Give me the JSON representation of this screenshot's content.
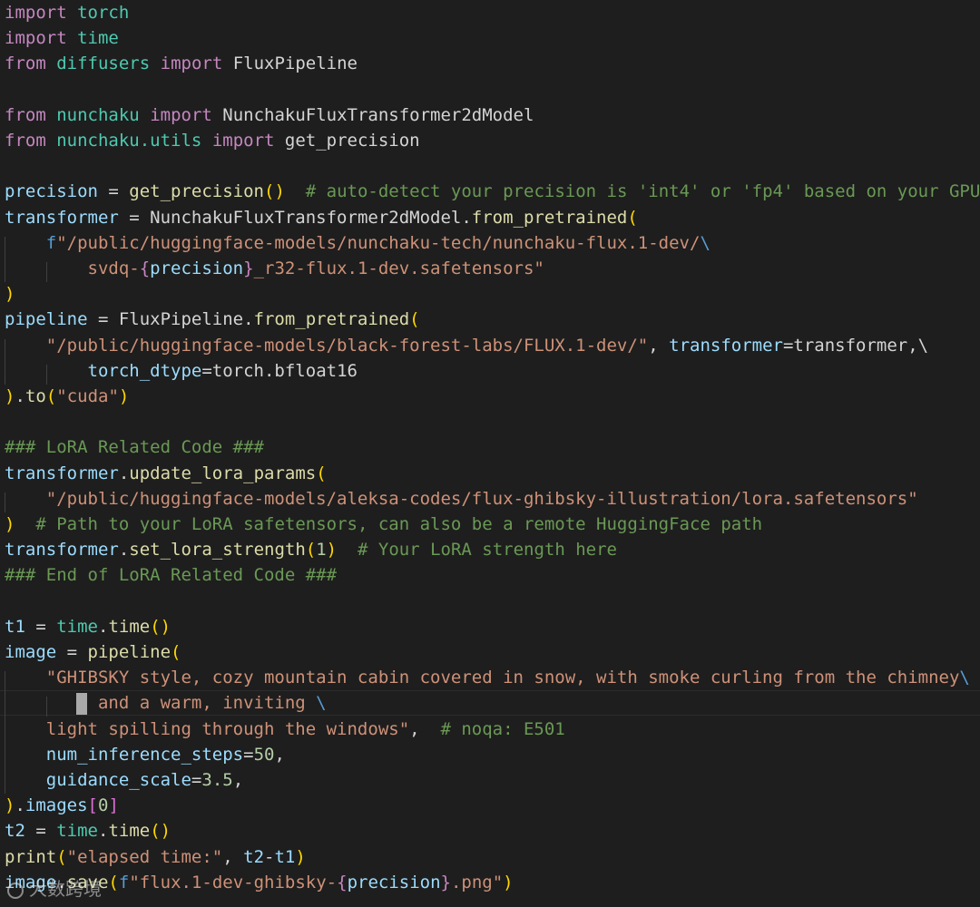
{
  "colors": {
    "background": "#1e1e1e",
    "keyword": "#c586c0",
    "function": "#dcdcaa",
    "variable": "#9cdcfe",
    "module": "#4ec9b0",
    "string": "#ce9178",
    "comment": "#6a9955",
    "number": "#b5cea8"
  },
  "editor": {
    "lines": [
      [
        {
          "t": "import",
          "c": "kw"
        },
        {
          "t": " "
        },
        {
          "t": "torch",
          "c": "mod"
        }
      ],
      [
        {
          "t": "import",
          "c": "kw"
        },
        {
          "t": " "
        },
        {
          "t": "time",
          "c": "mod"
        }
      ],
      [
        {
          "t": "from",
          "c": "kw"
        },
        {
          "t": " "
        },
        {
          "t": "diffusers",
          "c": "mod"
        },
        {
          "t": " "
        },
        {
          "t": "import",
          "c": "kw"
        },
        {
          "t": " FluxPipeline"
        }
      ],
      [],
      [
        {
          "t": "from",
          "c": "kw"
        },
        {
          "t": " "
        },
        {
          "t": "nunchaku",
          "c": "mod"
        },
        {
          "t": " "
        },
        {
          "t": "import",
          "c": "kw"
        },
        {
          "t": " NunchakuFluxTransformer2dModel"
        }
      ],
      [
        {
          "t": "from",
          "c": "kw"
        },
        {
          "t": " "
        },
        {
          "t": "nunchaku.utils",
          "c": "mod"
        },
        {
          "t": " "
        },
        {
          "t": "import",
          "c": "kw"
        },
        {
          "t": " get_precision"
        }
      ],
      [],
      [
        {
          "t": "precision",
          "c": "var"
        },
        {
          "t": " = "
        },
        {
          "t": "get_precision",
          "c": "fn"
        },
        {
          "t": "()",
          "c": "p1"
        },
        {
          "t": "  "
        },
        {
          "t": "# auto-detect your precision is 'int4' or 'fp4' based on your GPU",
          "c": "com"
        }
      ],
      [
        {
          "t": "transformer",
          "c": "var"
        },
        {
          "t": " = NunchakuFluxTransformer2dModel."
        },
        {
          "t": "from_pretrained",
          "c": "fn"
        },
        {
          "t": "(",
          "c": "p1"
        }
      ],
      [
        {
          "t": "    "
        },
        {
          "t": "f",
          "c": "fstr"
        },
        {
          "t": "\"/public/huggingface-models/nunchaku-tech/nunchaku-flux.1-dev/",
          "c": "str"
        },
        {
          "t": "\\",
          "c": "fstr"
        }
      ],
      [
        {
          "t": "        "
        },
        {
          "t": "svdq-",
          "c": "str"
        },
        {
          "t": "{",
          "c": "brace"
        },
        {
          "t": "precision",
          "c": "var"
        },
        {
          "t": "}",
          "c": "brace"
        },
        {
          "t": "_r32-flux.1-dev.safetensors\"",
          "c": "str"
        }
      ],
      [
        {
          "t": ")",
          "c": "p1"
        }
      ],
      [
        {
          "t": "pipeline",
          "c": "var"
        },
        {
          "t": " = FluxPipeline."
        },
        {
          "t": "from_pretrained",
          "c": "fn"
        },
        {
          "t": "(",
          "c": "p1"
        }
      ],
      [
        {
          "t": "    "
        },
        {
          "t": "\"/public/huggingface-models/black-forest-labs/FLUX.1-dev/\"",
          "c": "str"
        },
        {
          "t": ", "
        },
        {
          "t": "transformer",
          "c": "var"
        },
        {
          "t": "=transformer,\\"
        }
      ],
      [
        {
          "t": "        "
        },
        {
          "t": "torch_dtype",
          "c": "var"
        },
        {
          "t": "=torch.bfloat16"
        }
      ],
      [
        {
          "t": ")",
          "c": "p1"
        },
        {
          "t": "."
        },
        {
          "t": "to",
          "c": "fn"
        },
        {
          "t": "(",
          "c": "p1"
        },
        {
          "t": "\"cuda\"",
          "c": "str"
        },
        {
          "t": ")",
          "c": "p1"
        }
      ],
      [],
      [
        {
          "t": "### LoRA Related Code ###",
          "c": "com"
        }
      ],
      [
        {
          "t": "transformer",
          "c": "var"
        },
        {
          "t": "."
        },
        {
          "t": "update_lora_params",
          "c": "fn"
        },
        {
          "t": "(",
          "c": "p1"
        }
      ],
      [
        {
          "t": "    "
        },
        {
          "t": "\"/public/huggingface-models/aleksa-codes/flux-ghibsky-illustration/lora.safetensors\"",
          "c": "str"
        }
      ],
      [
        {
          "t": ")",
          "c": "p1"
        },
        {
          "t": "  "
        },
        {
          "t": "# Path to your LoRA safetensors, can also be a remote HuggingFace path",
          "c": "com"
        }
      ],
      [
        {
          "t": "transformer",
          "c": "var"
        },
        {
          "t": "."
        },
        {
          "t": "set_lora_strength",
          "c": "fn"
        },
        {
          "t": "(",
          "c": "p1"
        },
        {
          "t": "1",
          "c": "num"
        },
        {
          "t": ")",
          "c": "p1"
        },
        {
          "t": "  "
        },
        {
          "t": "# Your LoRA strength here",
          "c": "com"
        }
      ],
      [
        {
          "t": "### End of LoRA Related Code ###",
          "c": "com"
        }
      ],
      [],
      [
        {
          "t": "t1",
          "c": "var"
        },
        {
          "t": " = "
        },
        {
          "t": "time",
          "c": "mod"
        },
        {
          "t": "."
        },
        {
          "t": "time",
          "c": "fn"
        },
        {
          "t": "()",
          "c": "p1"
        }
      ],
      [
        {
          "t": "image",
          "c": "var"
        },
        {
          "t": " = "
        },
        {
          "t": "pipeline",
          "c": "fn"
        },
        {
          "t": "(",
          "c": "p1"
        }
      ],
      [
        {
          "t": "    "
        },
        {
          "t": "\"GHIBSKY style, cozy mountain cabin covered in snow, with smoke curling from the chimney",
          "c": "str"
        },
        {
          "t": "\\",
          "c": "fstr"
        }
      ],
      [
        {
          "t": "         "
        },
        {
          "t": "and a warm, inviting ",
          "c": "str"
        },
        {
          "t": "\\",
          "c": "fstr"
        }
      ],
      [
        {
          "t": "    "
        },
        {
          "t": "light spilling through the windows\"",
          "c": "str"
        },
        {
          "t": ",  "
        },
        {
          "t": "# noqa: E501",
          "c": "com"
        }
      ],
      [
        {
          "t": "    "
        },
        {
          "t": "num_inference_steps",
          "c": "var"
        },
        {
          "t": "="
        },
        {
          "t": "50",
          "c": "num"
        },
        {
          "t": ","
        }
      ],
      [
        {
          "t": "    "
        },
        {
          "t": "guidance_scale",
          "c": "var"
        },
        {
          "t": "="
        },
        {
          "t": "3.5",
          "c": "num"
        },
        {
          "t": ","
        }
      ],
      [
        {
          "t": ")",
          "c": "p1"
        },
        {
          "t": "."
        },
        {
          "t": "images",
          "c": "var"
        },
        {
          "t": "[",
          "c": "p2"
        },
        {
          "t": "0",
          "c": "num"
        },
        {
          "t": "]",
          "c": "p2"
        }
      ],
      [
        {
          "t": "t2",
          "c": "var"
        },
        {
          "t": " = "
        },
        {
          "t": "time",
          "c": "mod"
        },
        {
          "t": "."
        },
        {
          "t": "time",
          "c": "fn"
        },
        {
          "t": "()",
          "c": "p1"
        }
      ],
      [
        {
          "t": "print",
          "c": "fn"
        },
        {
          "t": "(",
          "c": "p1"
        },
        {
          "t": "\"elapsed time:\"",
          "c": "str"
        },
        {
          "t": ", "
        },
        {
          "t": "t2",
          "c": "var"
        },
        {
          "t": "-"
        },
        {
          "t": "t1",
          "c": "var"
        },
        {
          "t": ")",
          "c": "p1"
        }
      ],
      [
        {
          "t": "image",
          "c": "var"
        },
        {
          "t": "."
        },
        {
          "t": "save",
          "c": "fn"
        },
        {
          "t": "(",
          "c": "p1"
        },
        {
          "t": "f",
          "c": "fstr"
        },
        {
          "t": "\"flux.1-dev-ghibsky-",
          "c": "str"
        },
        {
          "t": "{",
          "c": "brace"
        },
        {
          "t": "precision",
          "c": "var"
        },
        {
          "t": "}",
          "c": "brace"
        },
        {
          "t": ".png\"",
          "c": "str"
        },
        {
          "t": ")",
          "c": "p1"
        }
      ]
    ]
  },
  "watermark": {
    "text": "大数跨境"
  }
}
